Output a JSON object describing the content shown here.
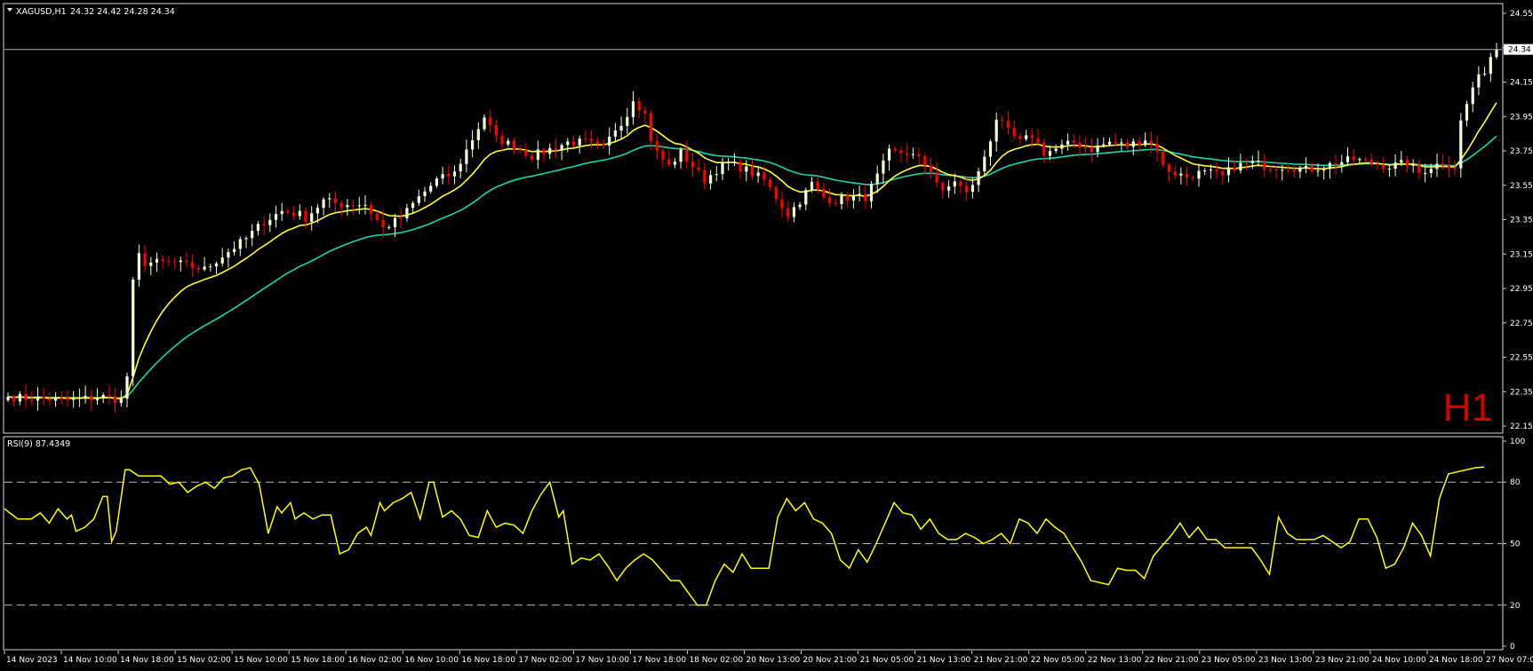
{
  "main_header": {
    "symbol": "XAGUSD,H1",
    "ohlc": "24.32 24.42 24.28 24.34"
  },
  "timeframe_label": "H1",
  "price_tag": "24.34",
  "rsi_header": "RSI(9) 87.4349",
  "colors": {
    "background": "#000000",
    "bull_candle": "#f0ffd8",
    "bear_candle": "#ff0000",
    "ma_fast": "#ffff33",
    "ma_slow": "#18d7b0",
    "rsi_line": "#ffff00",
    "grid_line": "#c8c8c8",
    "timeframe_label": "#d40000"
  },
  "chart_data": [
    {
      "type": "candlestick",
      "symbol": "XAGUSD",
      "timeframe": "H1",
      "ylim": [
        22.15,
        24.55
      ],
      "y_ticks": [
        "24.55",
        "24.35",
        "24.15",
        "23.95",
        "23.75",
        "23.55",
        "23.35",
        "23.15",
        "22.95",
        "22.75",
        "22.55",
        "22.35",
        "22.15"
      ],
      "x_labels": [
        "14 Nov 2023",
        "14 Nov 10:00",
        "14 Nov 18:00",
        "15 Nov 02:00",
        "15 Nov 10:00",
        "15 Nov 18:00",
        "16 Nov 02:00",
        "16 Nov 10:00",
        "16 Nov 18:00",
        "17 Nov 02:00",
        "17 Nov 10:00",
        "17 Nov 18:00",
        "18 Nov 02:00",
        "20 Nov 13:00",
        "20 Nov 21:00",
        "21 Nov 05:00",
        "21 Nov 13:00",
        "21 Nov 21:00",
        "22 Nov 05:00",
        "22 Nov 13:00",
        "22 Nov 21:00",
        "23 Nov 05:00",
        "23 Nov 13:00",
        "23 Nov 21:00",
        "24 Nov 10:00",
        "24 Nov 18:00",
        "27 Nov 07:00"
      ],
      "close_anchors": [
        [
          0,
          22.32
        ],
        [
          10,
          22.3
        ],
        [
          16,
          22.32
        ],
        [
          19,
          22.3
        ],
        [
          20,
          22.44
        ],
        [
          21,
          22.98
        ],
        [
          22,
          23.14
        ],
        [
          23,
          23.1
        ],
        [
          28,
          23.1
        ],
        [
          33,
          23.06
        ],
        [
          36,
          23.14
        ],
        [
          40,
          23.24
        ],
        [
          43,
          23.34
        ],
        [
          46,
          23.4
        ],
        [
          49,
          23.38
        ],
        [
          50,
          23.36
        ],
        [
          53,
          23.46
        ],
        [
          56,
          23.44
        ],
        [
          60,
          23.44
        ],
        [
          63,
          23.3
        ],
        [
          66,
          23.36
        ],
        [
          69,
          23.48
        ],
        [
          72,
          23.58
        ],
        [
          75,
          23.62
        ],
        [
          78,
          23.82
        ],
        [
          80,
          23.95
        ],
        [
          82,
          23.82
        ],
        [
          85,
          23.78
        ],
        [
          88,
          23.72
        ],
        [
          91,
          23.76
        ],
        [
          94,
          23.8
        ],
        [
          97,
          23.8
        ],
        [
          100,
          23.76
        ],
        [
          102,
          23.88
        ],
        [
          104,
          23.96
        ],
        [
          105,
          24.06
        ],
        [
          107,
          23.96
        ],
        [
          108,
          23.82
        ],
        [
          109,
          23.74
        ],
        [
          111,
          23.66
        ],
        [
          113,
          23.74
        ],
        [
          115,
          23.66
        ],
        [
          117,
          23.58
        ],
        [
          119,
          23.64
        ],
        [
          121,
          23.68
        ],
        [
          124,
          23.64
        ],
        [
          127,
          23.58
        ],
        [
          129,
          23.48
        ],
        [
          131,
          23.38
        ],
        [
          133,
          23.46
        ],
        [
          135,
          23.56
        ],
        [
          137,
          23.48
        ],
        [
          139,
          23.46
        ],
        [
          141,
          23.48
        ],
        [
          144,
          23.48
        ],
        [
          146,
          23.6
        ],
        [
          148,
          23.74
        ],
        [
          151,
          23.74
        ],
        [
          153,
          23.7
        ],
        [
          155,
          23.64
        ],
        [
          157,
          23.5
        ],
        [
          159,
          23.58
        ],
        [
          161,
          23.5
        ],
        [
          163,
          23.62
        ],
        [
          165,
          23.82
        ],
        [
          166,
          23.94
        ],
        [
          168,
          23.86
        ],
        [
          170,
          23.8
        ],
        [
          172,
          23.84
        ],
        [
          174,
          23.74
        ],
        [
          176,
          23.76
        ],
        [
          179,
          23.8
        ],
        [
          182,
          23.76
        ],
        [
          185,
          23.8
        ],
        [
          188,
          23.78
        ],
        [
          191,
          23.82
        ],
        [
          193,
          23.76
        ],
        [
          194,
          23.66
        ],
        [
          196,
          23.62
        ],
        [
          198,
          23.6
        ],
        [
          200,
          23.62
        ],
        [
          202,
          23.62
        ],
        [
          204,
          23.6
        ],
        [
          206,
          23.66
        ],
        [
          209,
          23.68
        ],
        [
          212,
          23.66
        ],
        [
          215,
          23.66
        ],
        [
          218,
          23.64
        ],
        [
          221,
          23.66
        ],
        [
          223,
          23.68
        ],
        [
          226,
          23.7
        ],
        [
          229,
          23.68
        ],
        [
          232,
          23.66
        ],
        [
          235,
          23.68
        ],
        [
          237,
          23.62
        ],
        [
          239,
          23.66
        ],
        [
          241,
          23.68
        ],
        [
          243,
          23.66
        ],
        [
          244,
          23.92
        ],
        [
          246,
          24.12
        ],
        [
          248,
          24.22
        ],
        [
          249,
          24.3
        ],
        [
          250,
          24.34
        ]
      ],
      "series": [
        {
          "name": "fast MA",
          "color": "#ffff33"
        },
        {
          "name": "slow MA",
          "color": "#18d7b0"
        }
      ]
    },
    {
      "type": "line",
      "indicator": "RSI(9)",
      "last_value": 87.4349,
      "ylim": [
        0,
        100
      ],
      "y_ticks": [
        100,
        80,
        50,
        20,
        0
      ],
      "levels": [
        80,
        50,
        20
      ],
      "anchors": [
        [
          0,
          67
        ],
        [
          3,
          62
        ],
        [
          6,
          62
        ],
        [
          8,
          65
        ],
        [
          10,
          60
        ],
        [
          12,
          67
        ],
        [
          14,
          62
        ],
        [
          15,
          64
        ],
        [
          16,
          56
        ],
        [
          18,
          58
        ],
        [
          20,
          62
        ],
        [
          22,
          73
        ],
        [
          23,
          73
        ],
        [
          24,
          51
        ],
        [
          25,
          56
        ],
        [
          27,
          86
        ],
        [
          28,
          86
        ],
        [
          30,
          83
        ],
        [
          33,
          83
        ],
        [
          35,
          83
        ],
        [
          37,
          79
        ],
        [
          39,
          80
        ],
        [
          41,
          75
        ],
        [
          43,
          78
        ],
        [
          45,
          80
        ],
        [
          47,
          77
        ],
        [
          49,
          82
        ],
        [
          51,
          83
        ],
        [
          53,
          86
        ],
        [
          55,
          87
        ],
        [
          57,
          79
        ],
        [
          59,
          55
        ],
        [
          61,
          68
        ],
        [
          62,
          65
        ],
        [
          64,
          70
        ],
        [
          65,
          62
        ],
        [
          67,
          65
        ],
        [
          69,
          62
        ],
        [
          71,
          64
        ],
        [
          73,
          64
        ],
        [
          75,
          45
        ],
        [
          77,
          47
        ],
        [
          79,
          55
        ],
        [
          81,
          58
        ],
        [
          82,
          54
        ],
        [
          84,
          70
        ],
        [
          85,
          66
        ],
        [
          87,
          70
        ],
        [
          89,
          72
        ],
        [
          91,
          75
        ],
        [
          93,
          62
        ],
        [
          95,
          80
        ],
        [
          96,
          80
        ],
        [
          98,
          63
        ],
        [
          100,
          66
        ],
        [
          102,
          62
        ],
        [
          104,
          54
        ],
        [
          106,
          53
        ],
        [
          108,
          66
        ],
        [
          110,
          58
        ],
        [
          112,
          60
        ],
        [
          114,
          59
        ],
        [
          116,
          55
        ],
        [
          118,
          66
        ],
        [
          120,
          74
        ],
        [
          122,
          80
        ],
        [
          124,
          63
        ],
        [
          125,
          66
        ],
        [
          127,
          40
        ],
        [
          129,
          43
        ],
        [
          131,
          42
        ],
        [
          133,
          45
        ],
        [
          135,
          39
        ],
        [
          137,
          32
        ],
        [
          139,
          38
        ],
        [
          141,
          42
        ],
        [
          143,
          45
        ],
        [
          145,
          42
        ],
        [
          147,
          37
        ],
        [
          149,
          32
        ],
        [
          151,
          32
        ],
        [
          153,
          26
        ],
        [
          155,
          20
        ],
        [
          157,
          20
        ],
        [
          159,
          32
        ],
        [
          161,
          40
        ],
        [
          163,
          36
        ],
        [
          165,
          45
        ],
        [
          167,
          38
        ],
        [
          169,
          38
        ],
        [
          171,
          38
        ],
        [
          173,
          63
        ],
        [
          175,
          72
        ],
        [
          177,
          66
        ],
        [
          179,
          70
        ],
        [
          181,
          62
        ],
        [
          183,
          60
        ],
        [
          185,
          55
        ],
        [
          187,
          42
        ],
        [
          189,
          38
        ],
        [
          191,
          47
        ],
        [
          193,
          41
        ],
        [
          195,
          50
        ],
        [
          197,
          60
        ],
        [
          199,
          70
        ],
        [
          201,
          65
        ],
        [
          203,
          64
        ],
        [
          205,
          57
        ],
        [
          207,
          62
        ],
        [
          209,
          55
        ],
        [
          211,
          52
        ],
        [
          213,
          52
        ],
        [
          215,
          55
        ],
        [
          217,
          53
        ],
        [
          219,
          50
        ],
        [
          221,
          52
        ],
        [
          223,
          55
        ],
        [
          225,
          50
        ],
        [
          227,
          62
        ],
        [
          229,
          60
        ],
        [
          231,
          55
        ],
        [
          233,
          62
        ],
        [
          235,
          58
        ],
        [
          237,
          55
        ],
        [
          239,
          48
        ],
        [
          241,
          41
        ],
        [
          243,
          32
        ],
        [
          245,
          31
        ],
        [
          247,
          30
        ],
        [
          249,
          38
        ],
        [
          251,
          37
        ],
        [
          253,
          37
        ],
        [
          255,
          33
        ],
        [
          257,
          44
        ],
        [
          259,
          49
        ],
        [
          261,
          54
        ],
        [
          263,
          60
        ],
        [
          265,
          53
        ],
        [
          267,
          58
        ],
        [
          269,
          52
        ],
        [
          271,
          52
        ],
        [
          273,
          48
        ],
        [
          275,
          48
        ],
        [
          277,
          48
        ],
        [
          279,
          48
        ],
        [
          281,
          42
        ],
        [
          283,
          35
        ],
        [
          285,
          63
        ],
        [
          287,
          55
        ],
        [
          289,
          52
        ],
        [
          291,
          52
        ],
        [
          293,
          52
        ],
        [
          295,
          54
        ],
        [
          297,
          51
        ],
        [
          299,
          48
        ],
        [
          301,
          51
        ],
        [
          303,
          62
        ],
        [
          305,
          62
        ],
        [
          307,
          53
        ],
        [
          309,
          38
        ],
        [
          311,
          40
        ],
        [
          313,
          48
        ],
        [
          315,
          60
        ],
        [
          317,
          54
        ],
        [
          319,
          44
        ],
        [
          321,
          72
        ],
        [
          323,
          84
        ],
        [
          325,
          85
        ],
        [
          327,
          86
        ],
        [
          329,
          87
        ],
        [
          331,
          87.4
        ]
      ]
    }
  ]
}
